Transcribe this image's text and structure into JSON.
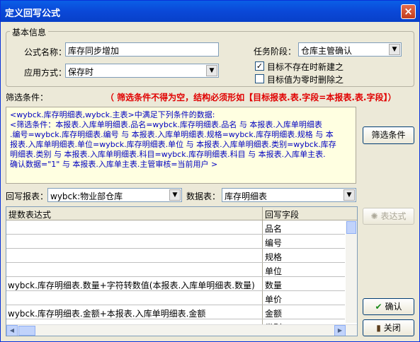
{
  "window": {
    "title": "定义回写公式",
    "close": "×"
  },
  "basic": {
    "group_label": "基本信息",
    "formula_name_label": "公式名称：",
    "formula_name_value": "库存同步增加",
    "apply_mode_label": "应用方式：",
    "apply_mode_value": "保存时",
    "task_stage_label": "任务阶段：",
    "task_stage_value": "仓库主管确认",
    "chk_create_label": "目标不存在时新建之",
    "chk_create_checked": true,
    "chk_delete_label": "目标值为零时删除之",
    "chk_delete_checked": false
  },
  "filter": {
    "label": "筛选条件：",
    "warning": "（ 筛选条件不得为空，结构必须形如【目标报表.表.字段=本报表.表.字段】）",
    "lines": [
      "<wybck.库存明细表,wybck.主表>中满足下列条件的数据:",
      "  <筛选条件：本报表.入库单明细表.品名=wybck.库存明细表.品名 与 本报表.入库单明细表",
      ".编号=wybck.库存明细表.编号 与 本报表.入库单明细表.规格=wybck.库存明细表.规格 与 本",
      "报表.入库单明细表.单位=wybck.库存明细表.单位 与 本报表.入库单明细表.类别=wybck.库存",
      "明细表.类别 与 本报表.入库单明细表.科目=wybck.库存明细表.科目 与 本报表.入库单主表.",
      "确认数据=\"1\" 与 本报表.入库单主表.主管审核=当前用户 >"
    ],
    "button": "筛选条件"
  },
  "writeback": {
    "report_label": "回写报表：",
    "report_value": "wybck:物业部仓库",
    "table_label": "数据表：",
    "table_value": "库存明细表"
  },
  "grid": {
    "col_expr": "提数表达式",
    "col_field": "回写字段",
    "rows": [
      {
        "expr": "",
        "field": "品名"
      },
      {
        "expr": "",
        "field": "编号"
      },
      {
        "expr": "",
        "field": "规格"
      },
      {
        "expr": "",
        "field": "单位"
      },
      {
        "expr": "wybck.库存明细表.数量+字符转数值(本报表.入库单明细表.数量)",
        "field": "数量"
      },
      {
        "expr": "",
        "field": "单价"
      },
      {
        "expr": "wybck.库存明细表.金额+本报表.入库单明细表.金额",
        "field": "金额"
      },
      {
        "expr": "",
        "field": "类别"
      }
    ]
  },
  "buttons": {
    "expr": "表达式",
    "ok": "确认",
    "close": "关闭"
  },
  "icons": [
    "close-icon",
    "dropdown-arrow-icon",
    "checkbox-icon",
    "bulb-icon",
    "checkmark-icon",
    "door-exit-icon",
    "scroll-arrow-icon"
  ]
}
